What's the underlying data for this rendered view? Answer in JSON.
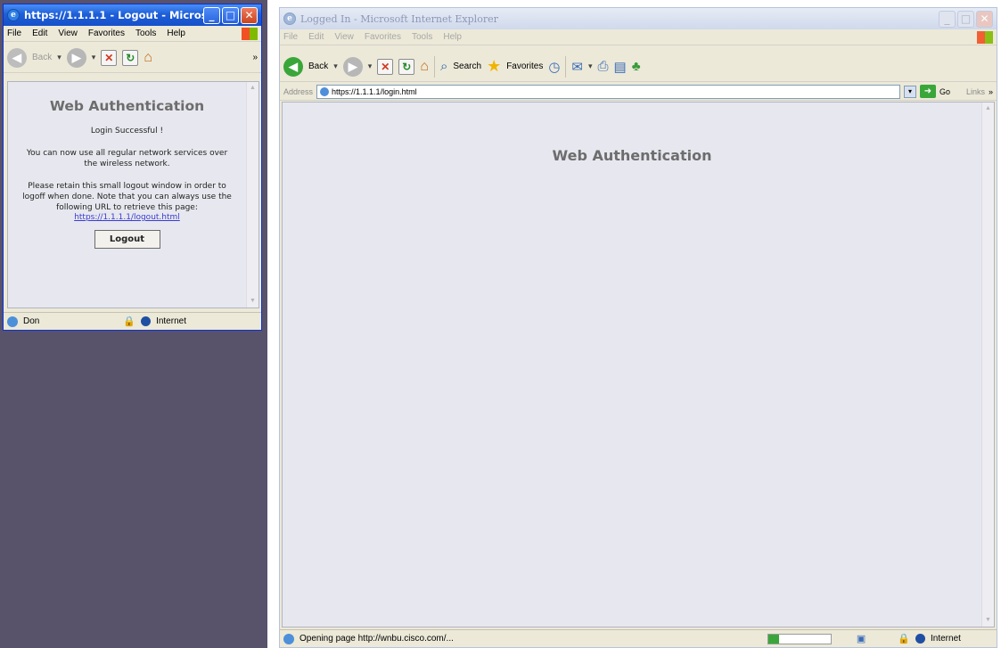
{
  "small_window": {
    "title": "https://1.1.1.1 - Logout - Micros...",
    "menu": [
      "File",
      "Edit",
      "View",
      "Favorites",
      "Tools",
      "Help"
    ],
    "toolbar": {
      "back_label": "Back",
      "chevron": "»"
    },
    "page": {
      "heading": "Web Authentication",
      "status": "Login Successful !",
      "para1": "You can now use all regular network services over the wireless network.",
      "para2": "Please retain this small logout window in order to logoff when done. Note that you can always use the following URL to retrieve this page:",
      "link": "https://1.1.1.1/logout.html",
      "button": "Logout"
    },
    "statusbar": {
      "left": "Don",
      "zone": "Internet"
    }
  },
  "main_window": {
    "title": "Logged In - Microsoft Internet Explorer",
    "menu": [
      "File",
      "Edit",
      "View",
      "Favorites",
      "Tools",
      "Help"
    ],
    "toolbar": {
      "back_label": "Back",
      "search_label": "Search",
      "favorites_label": "Favorites"
    },
    "address": {
      "label": "Address",
      "url": "https://1.1.1.1/login.html",
      "go_label": "Go",
      "links_label": "Links",
      "chevron": "»"
    },
    "page": {
      "heading": "Web Authentication"
    },
    "statusbar": {
      "text": "Opening page http://wnbu.cisco.com/...",
      "zone": "Internet"
    }
  },
  "colors": {
    "desktop": "#58526b",
    "content_bg": "#e7e8ef",
    "chrome": "#ece9d8",
    "active_title": "#1e5fd8"
  },
  "icons": [
    "ie-logo-icon",
    "minimize-icon",
    "maximize-icon",
    "close-icon",
    "back-icon",
    "forward-icon",
    "stop-icon",
    "refresh-icon",
    "home-icon",
    "search-icon",
    "favorites-star-icon",
    "media-icon",
    "history-icon",
    "mail-icon",
    "print-icon",
    "edit-icon",
    "messenger-icon",
    "windows-flag-icon",
    "lock-icon",
    "globe-icon"
  ]
}
